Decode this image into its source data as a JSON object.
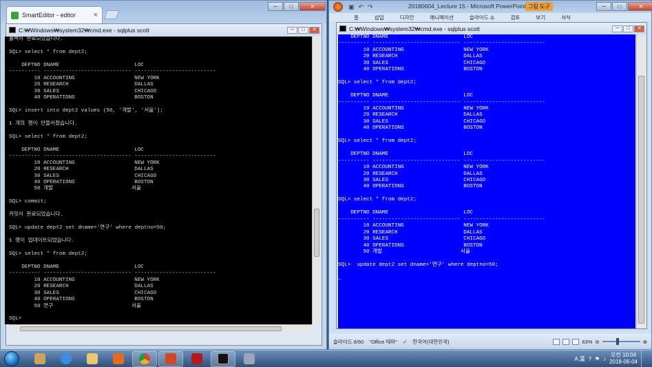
{
  "chrome": {
    "tab_title": "SmartEditor - editor",
    "tab_close": "×"
  },
  "left_cmd": {
    "title": "C:₩Windows₩system32₩cmd.exe - sqlplus  scott",
    "lines": [
      "롤백이 완료되었습니다.",
      "",
      "SQL> select * from dept2;",
      "",
      "    DEPTNO DNAME                        LOC",
      "---------- ---------------------------- --------------------------",
      "        10 ACCOUNTING                   NEW YORK",
      "        20 RESEARCH                     DALLAS",
      "        30 SALES                        CHICAGO",
      "        40 OPERATIONS                   BOSTON",
      "",
      "SQL> insert into dept2 values (50, '개발', '서울');",
      "",
      "1 개의 행이 만들어졌습니다.",
      "",
      "SQL> select * from dept2;",
      "",
      "    DEPTNO DNAME                        LOC",
      "---------- ---------------------------- --------------------------",
      "        10 ACCOUNTING                   NEW YORK",
      "        20 RESEARCH                     DALLAS",
      "        30 SALES                        CHICAGO",
      "        40 OPERATIONS                   BOSTON",
      "        50 개발                         서울",
      "",
      "SQL> commit;",
      "",
      "커밋이 완료되었습니다.",
      "",
      "SQL> update dept2 set dname='연구' where deptno=50;",
      "",
      "1 행이 업데이트되었습니다.",
      "",
      "SQL> select * from dept2;",
      "",
      "    DEPTNO DNAME                        LOC",
      "---------- ---------------------------- --------------------------",
      "        10 ACCOUNTING                   NEW YORK",
      "        20 RESEARCH                     DALLAS",
      "        30 SALES                        CHICAGO",
      "        40 OPERATIONS                   BOSTON",
      "        50 연구                         서울",
      "",
      "SQL>"
    ]
  },
  "ppt": {
    "title": "20180604_Lecture 15 - Microsoft PowerPoint",
    "context_tab": "그림 도구",
    "ribbon_tabs": [
      "홈",
      "삽입",
      "디자인",
      "애니메이션",
      "슬라이드 쇼",
      "검토",
      "보기",
      "서식"
    ],
    "status": {
      "slide": "슬라이드 8/60",
      "theme": "\"Office 테마\"",
      "language": "한국어(대한민국)",
      "zoom": "63%"
    }
  },
  "right_cmd": {
    "title": "C:₩Windows₩system32₩cmd.exe - sqlplus  scott",
    "lines": [
      "    DEPTNO DNAME                        LOC",
      "---------- ---------------------------- --------------------------",
      "        10 ACCOUNTING                   NEW YORK",
      "        20 RESEARCH                     DALLAS",
      "        30 SALES                        CHICAGO",
      "        40 OPERATIONS                   BOSTON",
      "",
      "SQL> select * from dept2;",
      "",
      "    DEPTNO DNAME                        LOC",
      "---------- ---------------------------- --------------------------",
      "        10 ACCOUNTING                   NEW YORK",
      "        20 RESEARCH                     DALLAS",
      "        30 SALES                        CHICAGO",
      "        40 OPERATIONS                   BOSTON",
      "",
      "SQL> select * from dept2;",
      "",
      "    DEPTNO DNAME                        LOC",
      "---------- ---------------------------- --------------------------",
      "        10 ACCOUNTING                   NEW YORK",
      "        20 RESEARCH                     DALLAS",
      "        30 SALES                        CHICAGO",
      "        40 OPERATIONS                   BOSTON",
      "",
      "SQL> select * from dept2;",
      "",
      "    DEPTNO DNAME                        LOC",
      "---------- ---------------------------- --------------------------",
      "        10 ACCOUNTING                   NEW YORK",
      "        20 RESEARCH                     DALLAS",
      "        30 SALES                        CHICAGO",
      "        40 OPERATIONS                   BOSTON",
      "        50 개발                         서울",
      "",
      "SQL>  update dept2 set dname='연구' where deptno=50;",
      "",
      "_"
    ]
  },
  "taskbar": {
    "tray_ime": "A 漢",
    "clock_time": "오전 10:04",
    "clock_date": "2018-06-04",
    "icons": [
      "explorer-icon",
      "ie-icon",
      "folder-icon",
      "media-player-icon",
      "chrome-icon",
      "presentation-icon",
      "pdf-icon",
      "cmd-icon",
      "network-tool-icon"
    ]
  },
  "colors": {
    "left_console_bg": "#000000",
    "right_console_bg": "#0000ff",
    "taskbar": "#2d507c"
  }
}
